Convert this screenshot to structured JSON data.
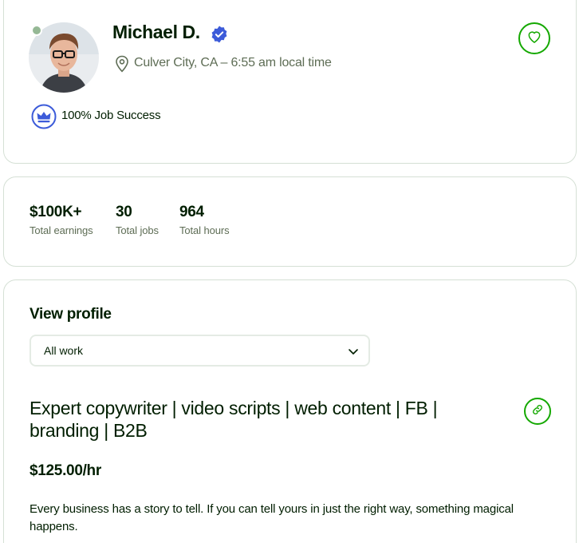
{
  "profile": {
    "name": "Michael D.",
    "location": "Culver City, CA – 6:55 am local time",
    "job_success": "100% Job Success"
  },
  "stats": [
    {
      "value": "$100K+",
      "label": "Total earnings"
    },
    {
      "value": "30",
      "label": "Total jobs"
    },
    {
      "value": "964",
      "label": "Total hours"
    }
  ],
  "detail": {
    "section_title": "View profile",
    "select_value": "All work",
    "headline": "Expert copywriter | video scripts | web content | FB | branding | B2B",
    "rate": "$125.00/hr",
    "overview": "Every business has a story to tell. If you can tell yours in just the right way, something magical happens."
  },
  "colors": {
    "accent": "#14a800",
    "verified_blue": "#3c5bd9",
    "text": "#001e00",
    "muted": "#5e6d55",
    "border": "#d5e0d5",
    "online_dot": "#95b895"
  },
  "icons": [
    "verified-badge-icon",
    "location-pin-icon",
    "heart-icon",
    "crown-badge-icon",
    "chevron-down-icon",
    "link-icon"
  ]
}
